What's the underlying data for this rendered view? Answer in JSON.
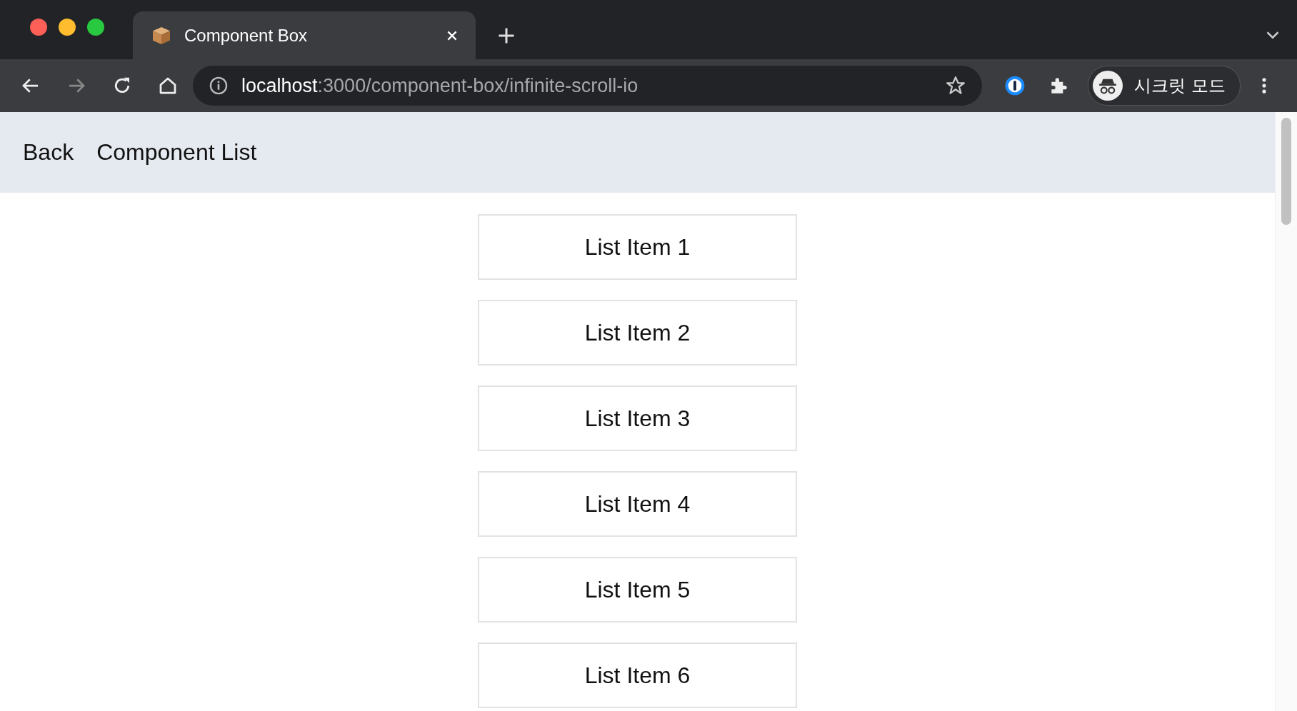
{
  "tab": {
    "title": "Component Box",
    "selected": true
  },
  "address_bar": {
    "host": "localhost",
    "path": ":3000/component-box/infinite-scroll-io"
  },
  "profile": {
    "label": "시크릿 모드"
  },
  "nav": {
    "links": [
      "Back",
      "Component List"
    ]
  },
  "list_items": [
    "List Item 1",
    "List Item 2",
    "List Item 3",
    "List Item 4",
    "List Item 5",
    "List Item 6"
  ]
}
